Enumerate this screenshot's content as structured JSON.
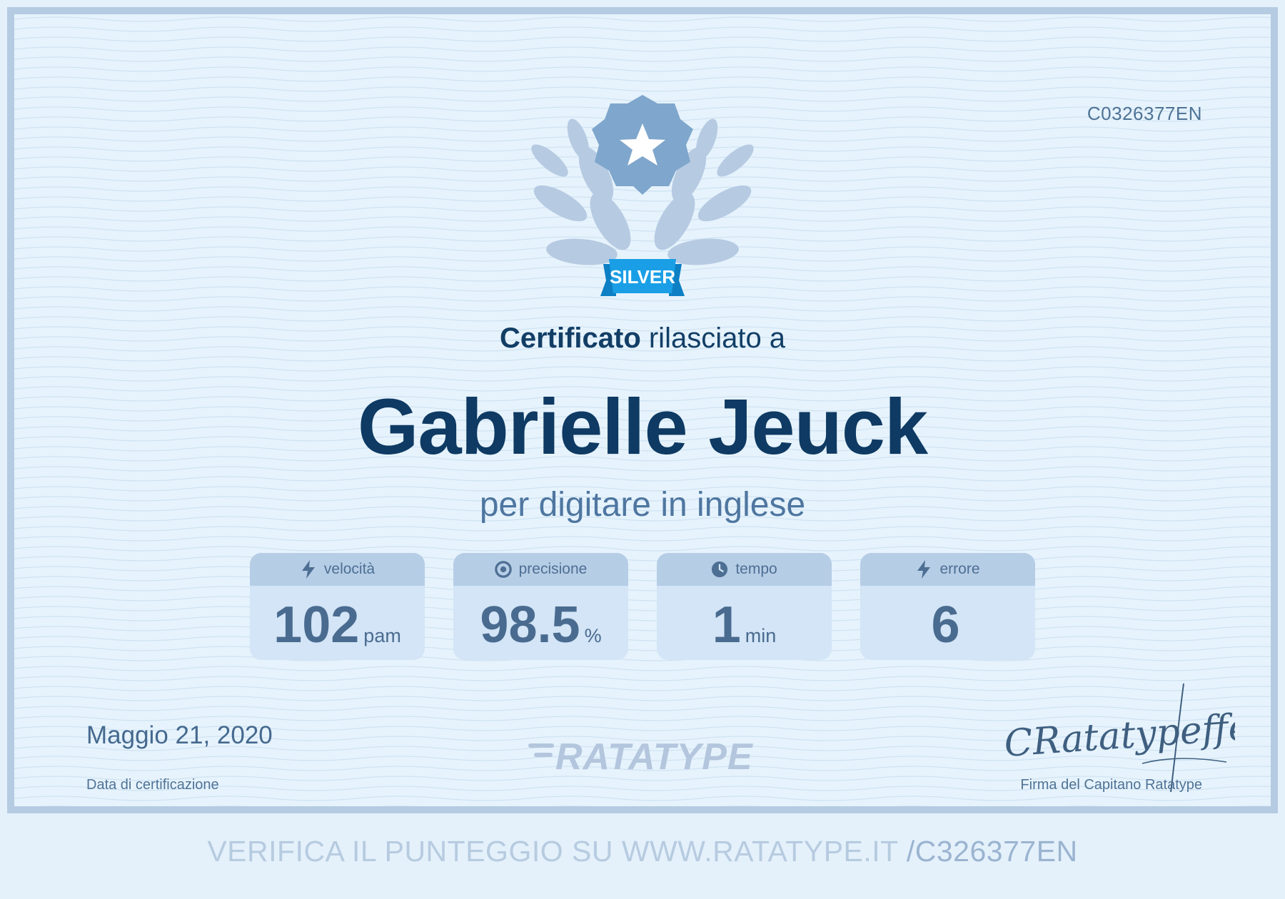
{
  "certificate": {
    "id": "C0326377EN",
    "level": "SILVER",
    "issued_bold": "Certificato",
    "issued_rest": " rilasciato a",
    "recipient": "Gabrielle Jeuck",
    "subject": "per digitare in inglese",
    "date": "Maggio 21, 2020",
    "date_label": "Data di certificazione",
    "signature_text": "CRatatypeffé",
    "signature_label": "Firma del Capitano Ratatype"
  },
  "stats": [
    {
      "icon": "lightning-icon",
      "label": "velocità",
      "value": "102",
      "unit": "pam"
    },
    {
      "icon": "target-icon",
      "label": "precisione",
      "value": "98.5",
      "unit": "%"
    },
    {
      "icon": "clock-icon",
      "label": "tempo",
      "value": "1",
      "unit": "min"
    },
    {
      "icon": "lightning-icon",
      "label": "errore",
      "value": "6",
      "unit": ""
    }
  ],
  "brand": {
    "logo_text": "RATATYPE"
  },
  "footer": {
    "verify_text": "VERIFICA IL PUNTEGGIO SU WWW.RATATYPE.IT ",
    "verify_code": "/C326377EN"
  },
  "colors": {
    "background": "#e6f3fc",
    "border": "#b5cbe2",
    "title": "#0e3a63",
    "ribbon": "#1a9fe6",
    "badge": "#7fa6cc",
    "laurel": "#b6cae2"
  }
}
